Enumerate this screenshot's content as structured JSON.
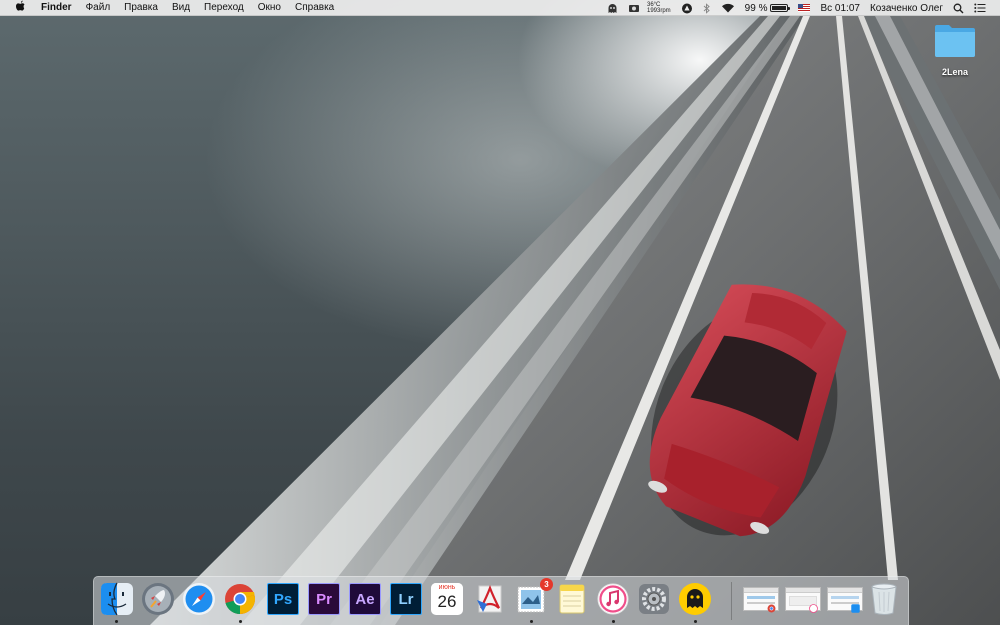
{
  "menubar": {
    "apple_icon": "apple-icon",
    "app_name": "Finder",
    "menus": [
      "Файл",
      "Правка",
      "Вид",
      "Переход",
      "Окно",
      "Справка"
    ],
    "fan_temp": "36°C",
    "fan_rpm": "1993rpm",
    "battery_percent": "99 %",
    "battery_level": 0.99,
    "clock": "Вс 01:07",
    "user_name": "Козаченко Олег"
  },
  "desktop": {
    "folder_label": "2Lena"
  },
  "dock": {
    "calendar_month": "июнь",
    "calendar_day": "26",
    "mail_badge": "3",
    "adobe": {
      "photoshop": "Ps",
      "premiere": "Pr",
      "after_effects": "Ae",
      "lightroom": "Lr"
    }
  },
  "colors": {
    "photoshop": "#31a8ff",
    "premiere": "#9999ff",
    "after_effects": "#9999ff",
    "lightroom": "#31a8ff",
    "adobe_bg": "#001e36",
    "folder": "#5fb8ee",
    "badge": "#e5382b"
  }
}
